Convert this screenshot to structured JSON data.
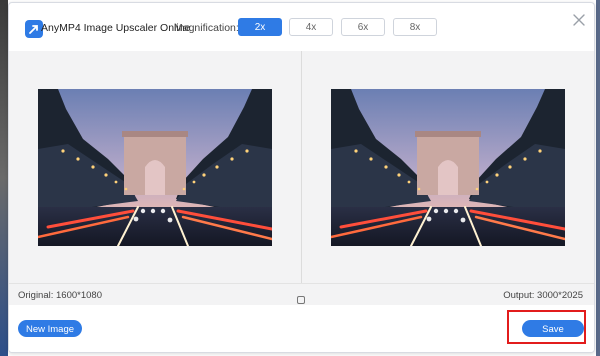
{
  "app": {
    "title": "AnyMP4 Image Upscaler Online",
    "logo_icon": "upscale-arrow-icon"
  },
  "magnification": {
    "label": "Magnification:",
    "options": [
      "2x",
      "4x",
      "6x",
      "8x"
    ],
    "selected": "2x"
  },
  "compare": {
    "original_label": "Original: 1600*1080",
    "output_label": "Output: 3000*2025",
    "center_icon": "compare-toggle-icon"
  },
  "actions": {
    "new_image": "New Image",
    "save": "Save"
  },
  "colors": {
    "accent": "#2f7be5",
    "highlight": "#e21c1c"
  }
}
